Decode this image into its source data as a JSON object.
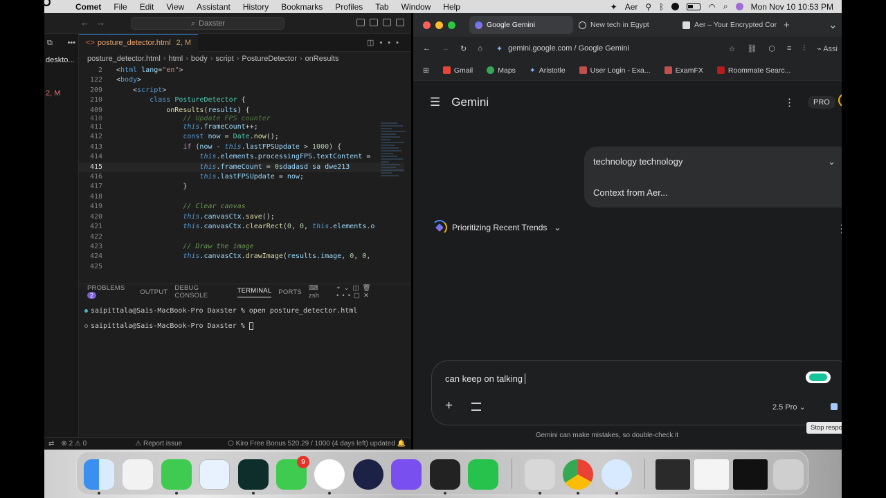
{
  "menubar": {
    "app": "Comet",
    "items": [
      "File",
      "Edit",
      "View",
      "Assistant",
      "History",
      "Bookmarks",
      "Profiles",
      "Tab",
      "Window",
      "Help"
    ],
    "aer": "Aer",
    "datetime": "Mon Nov 10  10:53 PM"
  },
  "vscode": {
    "search": "Daxster",
    "sidebar_file": "deskto...",
    "sidebar_badge": "2, M",
    "tab": {
      "name": "posture_detector.html",
      "status": "2, M"
    },
    "breadcrumb": [
      "posture_detector.html",
      "html",
      "body",
      "script",
      "PostureDetector",
      "onResults"
    ],
    "panel_tabs": {
      "problems": "PROBLEMS",
      "problems_count": "2",
      "output": "OUTPUT",
      "debug": "DEBUG CONSOLE",
      "terminal": "TERMINAL",
      "ports": "PORTS",
      "shell": "zsh"
    },
    "terminal": {
      "line1": "saipittala@Sais-MacBook-Pro Daxster  % open posture_detector.html",
      "line2": "saipittala@Sais-MacBook-Pro Daxster  % "
    },
    "status": {
      "errors": "2",
      "warnings": "0",
      "report": "Report issue",
      "kiro": "Kiro Free Bonus 520.29 / 1000 (4 days left) updated"
    }
  },
  "browser": {
    "tabs": [
      {
        "label": "Google Gemini",
        "color": "#8ab4f8"
      },
      {
        "label": "New tech in Egypt",
        "color": "#cccccc"
      },
      {
        "label": "Aer – Your Encrypted Cor",
        "color": "#dddddd"
      }
    ],
    "url": "gemini.google.com / Google Gemini",
    "assist": "Assi",
    "bookmarks": [
      {
        "label": "Gmail",
        "color": "#ea4335"
      },
      {
        "label": "Maps",
        "color": "#34a853"
      },
      {
        "label": "Aristotle",
        "color": "#8ab4f8"
      },
      {
        "label": "User Login - Exa...",
        "color": "#c0504d"
      },
      {
        "label": "ExamFX",
        "color": "#c0504d"
      },
      {
        "label": "Roommate Searc...",
        "color": "#b71c1c"
      }
    ]
  },
  "gemini": {
    "title": "Gemini",
    "plan": "PRO",
    "query": "technology technology",
    "context": "Context from Aer...",
    "thinking": "Prioritizing Recent Trends",
    "input": "can keep on talking",
    "model": "2.5 Pro",
    "disclaimer": "Gemini can make mistakes, so double-check it",
    "tooltip": "Stop respo"
  },
  "dock": {
    "facetime_badge": "9"
  }
}
